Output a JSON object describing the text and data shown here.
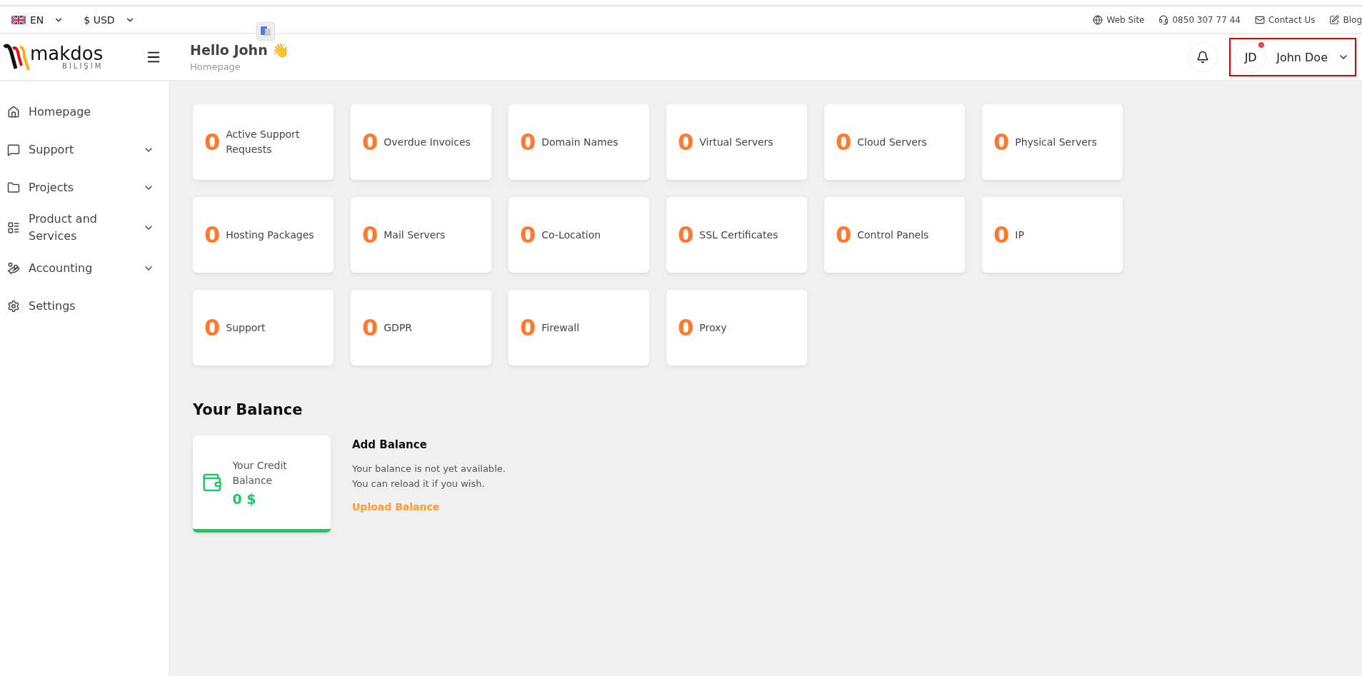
{
  "top_bar": {
    "language": "EN",
    "currency": "$ USD",
    "links": [
      {
        "kind": "globe",
        "label": "Web Site"
      },
      {
        "kind": "headset",
        "label": "0850 307 77 44"
      },
      {
        "kind": "mail",
        "label": "Contact Us"
      },
      {
        "kind": "edit",
        "label": "Blog"
      }
    ]
  },
  "header": {
    "logo": {
      "name": "makdos",
      "sub": "BILIŞIM"
    },
    "greeting": "Hello John 👋",
    "breadcrumb": "Homepage",
    "user": {
      "initials": "JD",
      "name": "John Doe",
      "has_notification": true,
      "highlighted": true
    }
  },
  "sidebar": {
    "items": [
      {
        "kind": "home",
        "label": "Homepage",
        "expandable": false
      },
      {
        "kind": "chat",
        "label": "Support",
        "expandable": true
      },
      {
        "kind": "folder",
        "label": "Projects",
        "expandable": true
      },
      {
        "kind": "list",
        "label": "Product and Services",
        "expandable": true
      },
      {
        "kind": "hand",
        "label": "Accounting",
        "expandable": true
      },
      {
        "kind": "gear",
        "label": "Settings",
        "expandable": false
      }
    ]
  },
  "stats": [
    {
      "count": "0",
      "label": "Active Support Requests"
    },
    {
      "count": "0",
      "label": "Overdue Invoices"
    },
    {
      "count": "0",
      "label": "Domain Names"
    },
    {
      "count": "0",
      "label": "Virtual Servers"
    },
    {
      "count": "0",
      "label": "Cloud Servers"
    },
    {
      "count": "0",
      "label": "Physical Servers"
    },
    {
      "count": "0",
      "label": "Hosting Packages"
    },
    {
      "count": "0",
      "label": "Mail Servers"
    },
    {
      "count": "0",
      "label": "Co-Location"
    },
    {
      "count": "0",
      "label": "SSL Certificates"
    },
    {
      "count": "0",
      "label": "Control Panels"
    },
    {
      "count": "0",
      "label": "IP"
    },
    {
      "count": "0",
      "label": "Support"
    },
    {
      "count": "0",
      "label": "GDPR"
    },
    {
      "count": "0",
      "label": "Firewall"
    },
    {
      "count": "0",
      "label": "Proxy"
    }
  ],
  "balance": {
    "title": "Your Balance",
    "card_label": "Your Credit Balance",
    "amount": "0 $",
    "add_title": "Add Balance",
    "add_text_lines": [
      "Your balance is not yet available.",
      "You can reload it if you wish."
    ],
    "link": "Upload Balance"
  }
}
